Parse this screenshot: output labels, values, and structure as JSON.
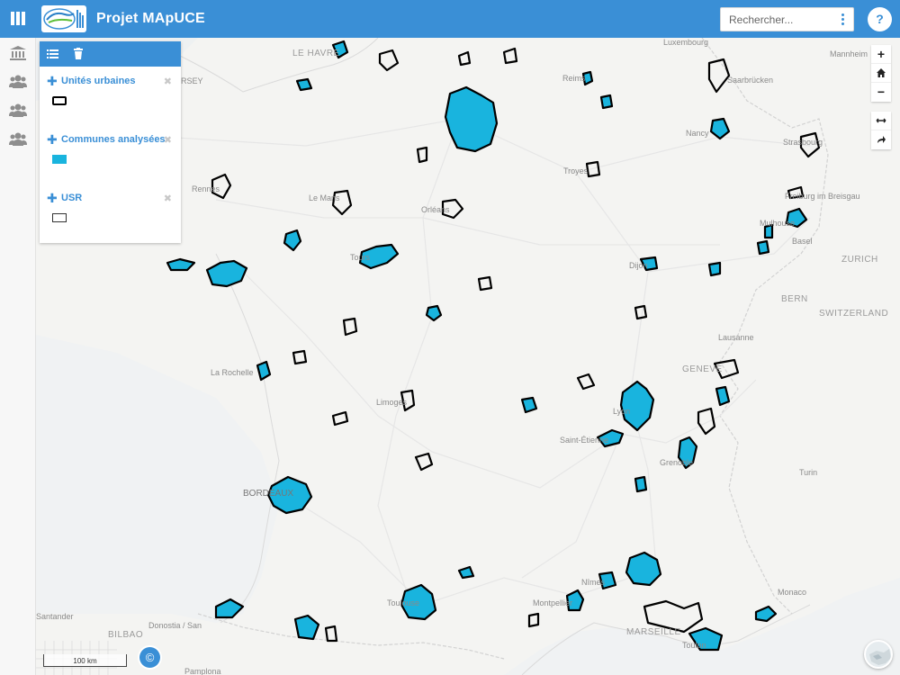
{
  "app": {
    "title": "Projet MApUCE",
    "logo_icon": "mapuce-logo"
  },
  "search": {
    "placeholder": "Rechercher..."
  },
  "help": {
    "label": "?"
  },
  "colors": {
    "accent": "#3a8fd6",
    "urban_fill": "#19b4de",
    "outline": "#000000",
    "map_bg": "#f4f4f2"
  },
  "sidebar": {
    "items": [
      {
        "icon": "institution-icon"
      },
      {
        "icon": "users-icon"
      },
      {
        "icon": "users-icon"
      },
      {
        "icon": "users-icon"
      }
    ]
  },
  "legend": {
    "tools": [
      "list-icon",
      "trash-icon"
    ],
    "layers": [
      {
        "name": "Unités urbaines",
        "close": "✖",
        "swatch": "outline"
      },
      {
        "name": "Communes analysées",
        "close": "✖",
        "swatch": "fill"
      },
      {
        "name": "USR",
        "close": "✖",
        "swatch": "thin-outline"
      }
    ]
  },
  "map_controls": {
    "zoom_in": "+",
    "home": "home-icon",
    "zoom_out": "−",
    "measure": "measure-icon",
    "share": "arrow-icon"
  },
  "scale": {
    "label": "100 km"
  },
  "attribution": {
    "label": "©"
  },
  "places": [
    "LE HAVRE",
    "ERSEY",
    "Luxembourg",
    "Mannheim",
    "Reims",
    "Saarbrücken",
    "Nancy",
    "Strasbourg",
    "Rennes",
    "Le Mans",
    "Orléans",
    "Troyes",
    "Freiburg im Breisgau",
    "Mulhouse",
    "Basel",
    "ZURICH",
    "Tours",
    "Dijon",
    "BERN",
    "SWITZERLAND",
    "Lausanne",
    "La Rochelle",
    "Limoges",
    "GENEVE",
    "Lyon",
    "Saint-Étienne",
    "Grenoble",
    "Turin",
    "BORDEAUX",
    "Nîmes",
    "Montpellier",
    "Toulouse",
    "MARSEILLE",
    "Monaco",
    "Santander",
    "Donostia / San",
    "BILBAO",
    "Pamplona",
    "Toulon"
  ]
}
